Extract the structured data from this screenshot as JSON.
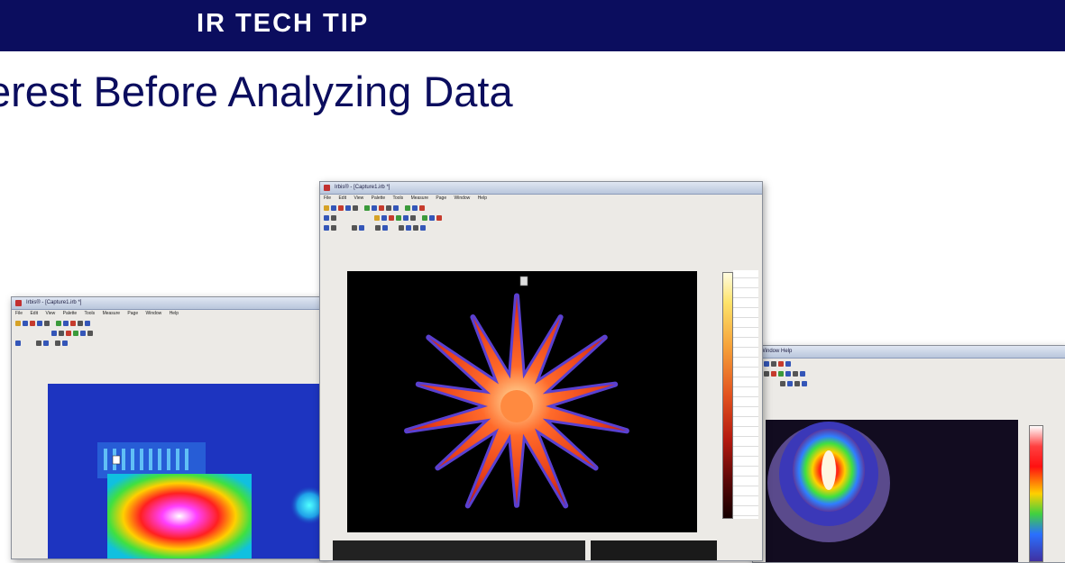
{
  "banner": {
    "title": "IR TECH TIP"
  },
  "page": {
    "title": "erest Before Analyzing Data"
  },
  "windows": {
    "left": {
      "title": "Irbis® - [Capture1.irb *]",
      "menu": [
        "File",
        "Edit",
        "View",
        "Palette",
        "Tools",
        "Measure",
        "Page",
        "Window",
        "Help"
      ]
    },
    "center": {
      "title": "Irbis® - [Capture1.irb *]",
      "menu": [
        "File",
        "Edit",
        "View",
        "Palette",
        "Tools",
        "Measure",
        "Page",
        "Window",
        "Help"
      ]
    },
    "right": {
      "title": "Window  Help",
      "menu": [
        "Window",
        "Help"
      ]
    }
  },
  "colors": {
    "banner_bg": "#0b0d5e",
    "title_color": "#0b0d5e",
    "accent_red": "#c63b2d"
  }
}
